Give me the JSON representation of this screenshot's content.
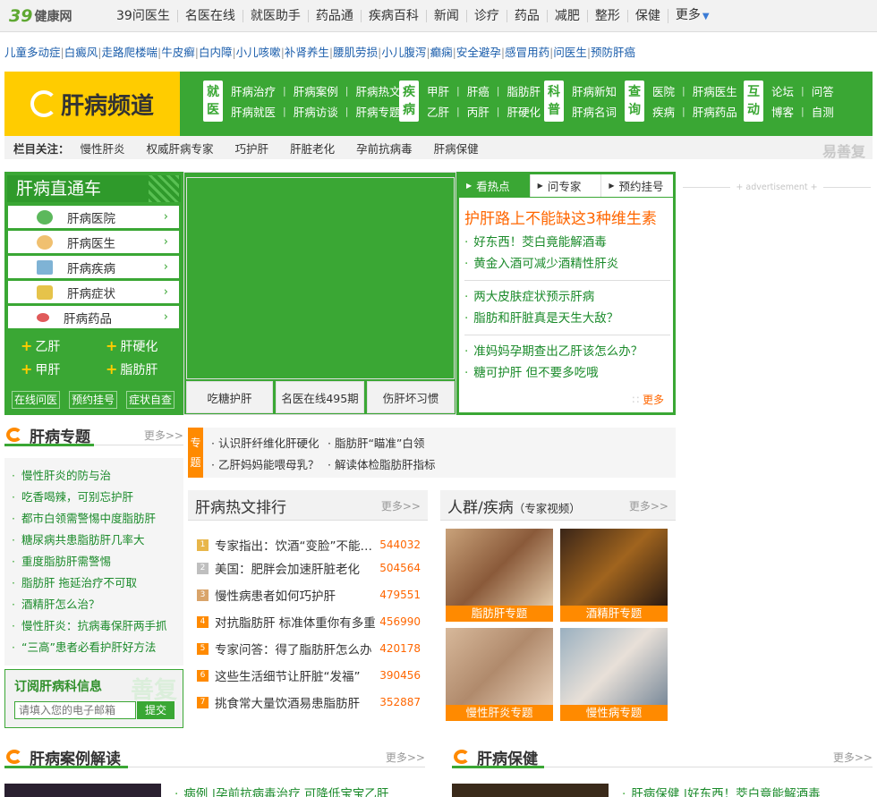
{
  "topnav": {
    "logo_num": "39",
    "logo_text": "健康网",
    "items": [
      "39问医生",
      "名医在线",
      "就医助手",
      "药品通",
      "疾病百科",
      "新闻",
      "诊疗",
      "药品",
      "减肥",
      "整形",
      "保健",
      "更多"
    ]
  },
  "linkrow": [
    "儿童多动症",
    "白癜风",
    "走路爬楼喘",
    "牛皮癣",
    "白内障",
    "小儿咳嗽",
    "补肾养生",
    "腰肌劳损",
    "小儿腹泻",
    "癫痫",
    "安全避孕",
    "感冒用药",
    "问医生",
    "预防肝癌"
  ],
  "channel": {
    "title": "肝病频道",
    "groups": [
      {
        "tag": [
          "就",
          "医"
        ],
        "row1": [
          "肝病治疗",
          "肝病案例",
          "肝病热文"
        ],
        "row2": [
          "肝病就医",
          "肝病访谈",
          "肝病专题"
        ]
      },
      {
        "tag": [
          "疾",
          "病"
        ],
        "row1": [
          "甲肝",
          "肝癌",
          "脂肪肝"
        ],
        "row2": [
          "乙肝",
          "丙肝",
          "肝硬化"
        ]
      },
      {
        "tag": [
          "科",
          "普"
        ],
        "row1": [
          "肝病新知"
        ],
        "row2": [
          "肝病名词"
        ]
      },
      {
        "tag": [
          "查",
          "询"
        ],
        "row1": [
          "医院",
          "肝病医生"
        ],
        "row2": [
          "疾病",
          "肝病药品"
        ]
      },
      {
        "tag": [
          "互",
          "动"
        ],
        "row1": [
          "论坛",
          "问答"
        ],
        "row2": [
          "博客",
          "自测"
        ]
      }
    ]
  },
  "colbar": {
    "label": "栏目关注：",
    "items": [
      "慢性肝炎",
      "权威肝病专家",
      "巧护肝",
      "肝脏老化",
      "孕前抗病毒",
      "肝病保健"
    ],
    "brand": "易善复"
  },
  "direct": {
    "title": "肝病直通车",
    "items": [
      "肝病医院",
      "肝病医生",
      "肝病疾病",
      "肝病症状",
      "肝病药品"
    ],
    "plus": [
      "乙肝",
      "肝硬化",
      "甲肝",
      "脂肪肝"
    ],
    "buttons": [
      "在线问医",
      "预约挂号",
      "症状自查"
    ]
  },
  "banner": {
    "tabs": [
      "吃糖护肝",
      "名医在线495期",
      "伤肝坏习惯"
    ]
  },
  "hot": {
    "tabs": [
      "看热点",
      "问专家",
      "预约挂号"
    ],
    "headline": "护肝路上不能缺这3种维生素",
    "group1": [
      "好东西！茭白竟能解酒毒",
      "黄金入酒可减少酒精性肝炎"
    ],
    "group2": [
      "两大皮肤症状预示肝病",
      "脂肪和肝脏真是天生大敌？"
    ],
    "group3": [
      "准妈妈孕期查出乙肝该怎么办？",
      "糖可护肝 但不要多吃哦"
    ],
    "more": "更多"
  },
  "ad": "advertisement",
  "topics": {
    "title": "肝病专题",
    "more": "更多>>",
    "items": [
      "慢性肝炎的防与治",
      "吃香喝辣，可别忘护肝",
      "都市白领需警惕中度脂肪肝",
      "糖尿病共患脂肪肝几率大",
      "重度脂肪肝需警惕",
      "脂肪肝 拖延治疗不可取",
      "酒精肝怎么治？",
      "慢性肝炎：抗病毒保肝两手抓",
      "“三高”患者必看护肝好方法"
    ]
  },
  "subscribe": {
    "title": "订阅肝病科信息",
    "watermark": "善复",
    "placeholder": "请填入您的电子邮箱",
    "button": "提交"
  },
  "special": {
    "tag": [
      "专",
      "题"
    ],
    "items": [
      "认识肝纤维化肝硬化",
      "脂肪肝“瞄准”白领",
      "乙肝妈妈能喂母乳？",
      "解读体检脂肪肝指标"
    ]
  },
  "rank": {
    "title": "肝病热文排行",
    "more": "更多>>",
    "rows": [
      {
        "num": "1",
        "title": "专家指出：饮酒“变脸”不能多喝",
        "count": "544032"
      },
      {
        "num": "2",
        "title": "美国：肥胖会加速肝脏老化",
        "count": "504564"
      },
      {
        "num": "3",
        "title": "慢性病患者如何巧护肝",
        "count": "479551"
      },
      {
        "num": "4",
        "title": "对抗脂肪肝 标准体重你有多重",
        "count": "456990"
      },
      {
        "num": "5",
        "title": "专家问答：得了脂肪肝怎么办",
        "count": "420178"
      },
      {
        "num": "6",
        "title": "这些生活细节让肝脏“发福”",
        "count": "390456"
      },
      {
        "num": "7",
        "title": "挑食常大量饮酒易患脂肪肝",
        "count": "352887"
      }
    ]
  },
  "crowd": {
    "title": "人群/疾病",
    "sub": "（专家视频）",
    "more": "更多>>",
    "pics": [
      "脂肪肝专题",
      "酒精肝专题",
      "慢性肝炎专题",
      "慢性病专题"
    ]
  },
  "cases": {
    "title": "肝病案例解读",
    "more": "更多>>",
    "line": "病例 |孕前抗病毒治疗 可降低宝宝乙肝"
  },
  "care": {
    "title": "肝病保健",
    "more": "更多>>",
    "line": "肝病保健 |好东西！茭白竟能解酒毒"
  }
}
